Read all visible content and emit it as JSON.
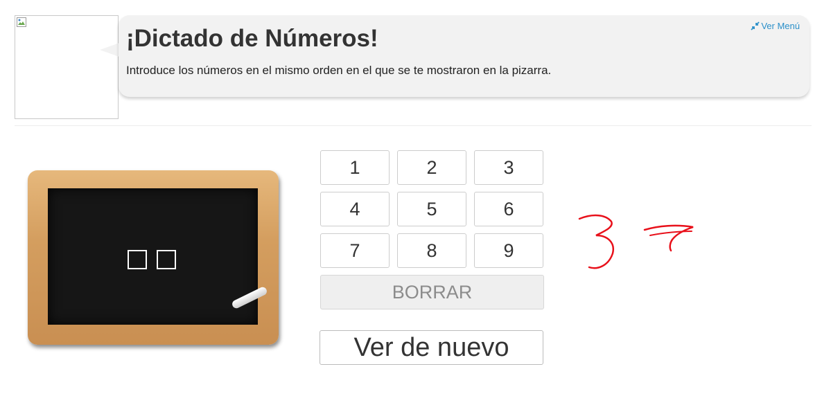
{
  "header": {
    "title": "¡Dictado de Números!",
    "instructions": "Introduce los números en el mismo orden en el que se te mostraron en la pizarra.",
    "menu_link": "Ver Menú",
    "menu_icon": "compress-arrows-icon"
  },
  "chalkboard": {
    "answer_slots": [
      "",
      ""
    ]
  },
  "keypad": {
    "keys": [
      "1",
      "2",
      "3",
      "4",
      "5",
      "6",
      "7",
      "8",
      "9"
    ],
    "clear_label": "BORRAR"
  },
  "replay_button": {
    "label": "Ver de nuevo"
  },
  "handwritten_note": {
    "text": "37",
    "color": "#e8101a"
  },
  "colors": {
    "link": "#2a8fc9",
    "bubble_bg": "#f2f2f2",
    "board_frame": "#d49e5f",
    "board_surface": "#161616"
  }
}
